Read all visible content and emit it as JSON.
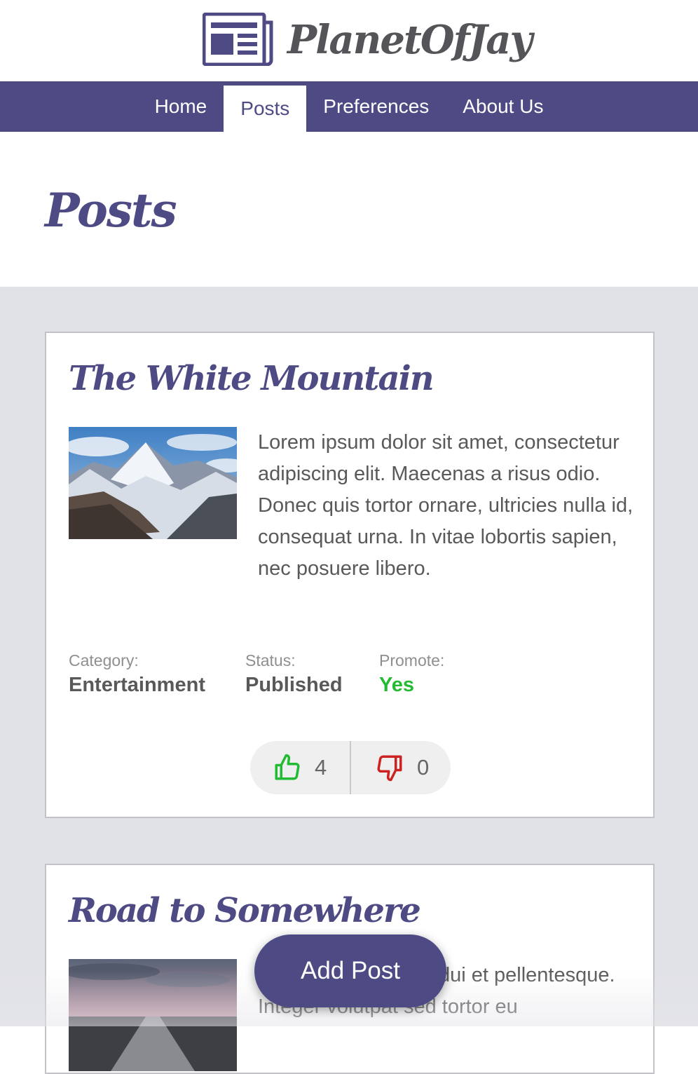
{
  "brand": {
    "name": "PlanetOfJay",
    "logo_icon": "newspaper-icon"
  },
  "nav": {
    "items": [
      {
        "label": "Home",
        "active": false
      },
      {
        "label": "Posts",
        "active": true
      },
      {
        "label": "Preferences",
        "active": false
      },
      {
        "label": "About Us",
        "active": false
      }
    ]
  },
  "page": {
    "title": "Posts"
  },
  "posts": [
    {
      "title": "The White Mountain",
      "image": "mountain-photo",
      "excerpt": "Lorem ipsum dolor sit amet, consectetur adipiscing elit. Maecenas a risus odio. Donec quis tortor ornare, ultricies nulla id, consequat urna. In vitae lobortis sapien, nec posuere libero.",
      "category_label": "Category:",
      "category": "Entertainment",
      "status_label": "Status:",
      "status": "Published",
      "promote_label": "Promote:",
      "promote": "Yes",
      "likes": "4",
      "dislikes": "0"
    },
    {
      "title": "Road to Somewhere",
      "image": "road-sunset-photo",
      "excerpt_line1": "dui et pellentesque.",
      "excerpt_line2": "Integer volutpat sed tortor eu"
    }
  ],
  "fab": {
    "label": "Add Post"
  },
  "colors": {
    "primary": "#4e4a84",
    "positive": "#22bb33",
    "negative": "#cc2222",
    "background": "#e1e2e7"
  }
}
